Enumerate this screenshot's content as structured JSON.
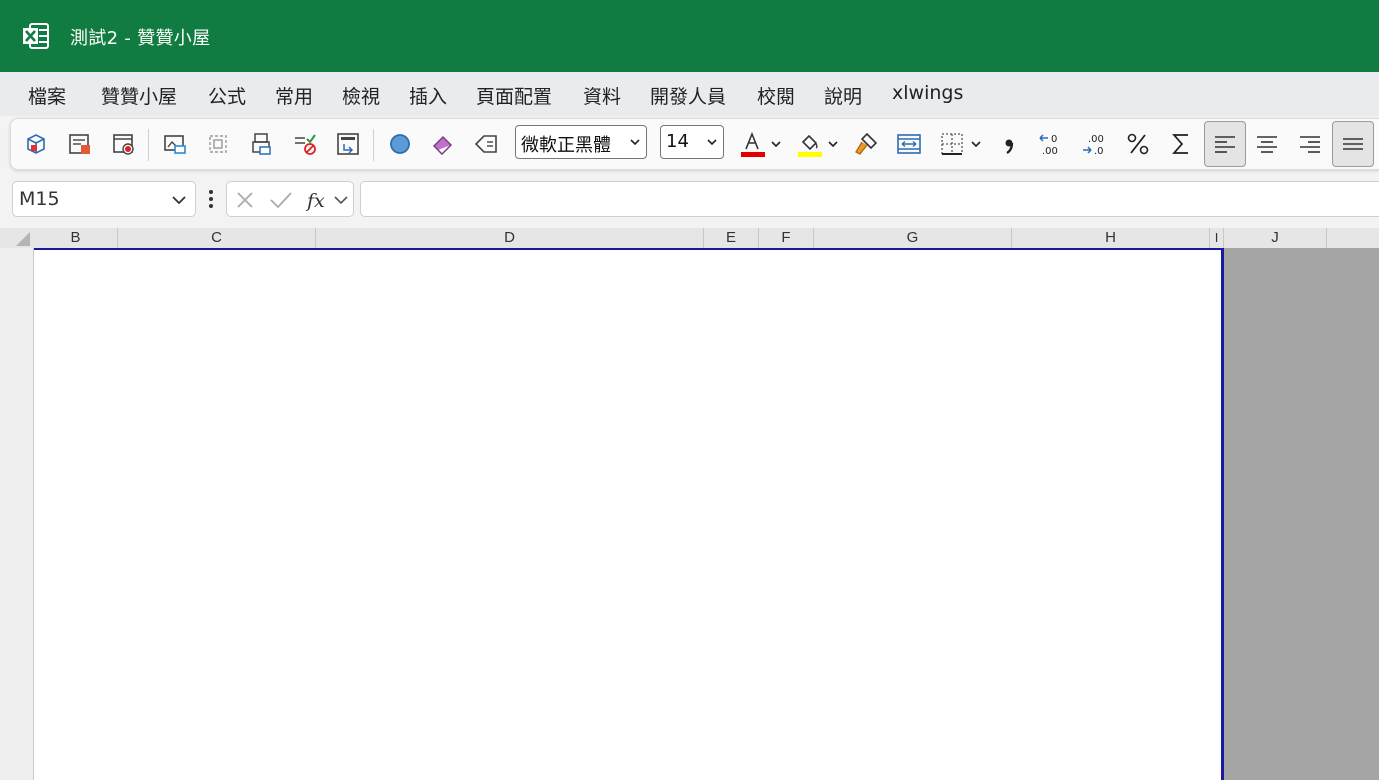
{
  "window": {
    "title": "測試2  -  贊贊小屋",
    "brand_color": "#107c41"
  },
  "menu": {
    "items": [
      "檔案",
      "贊贊小屋",
      "公式",
      "常用",
      "檢視",
      "插入",
      "頁面配置",
      "資料",
      "開發人員",
      "校閱",
      "說明",
      "xlwings"
    ]
  },
  "toolbar": {
    "font_name": "微軟正黑體",
    "font_size": "14",
    "icons": [
      "3d-box-icon",
      "print-preview-icon",
      "record-macro-icon",
      "camera-icon",
      "select-objects-icon",
      "print-area-icon",
      "clear-validation-icon",
      "page-setup-icon",
      "circle-shape-icon",
      "eraser-icon",
      "clear-format-icon",
      "font-color-icon",
      "fill-color-icon",
      "format-painter-icon",
      "merge-cells-icon",
      "borders-icon",
      "comma-style-icon",
      "decrease-decimal-icon",
      "increase-decimal-icon",
      "percent-style-icon",
      "autosum-icon",
      "align-left-icon",
      "align-center-icon",
      "align-right-icon",
      "align-middle-icon"
    ],
    "font_color": "#e00000",
    "fill_color": "#ffff00"
  },
  "formula_bar": {
    "name_box": "M15",
    "formula": ""
  },
  "grid": {
    "columns": [
      "B",
      "C",
      "D",
      "E",
      "F",
      "G",
      "H",
      "I",
      "J"
    ],
    "selection_color": "#1a1aa0"
  }
}
